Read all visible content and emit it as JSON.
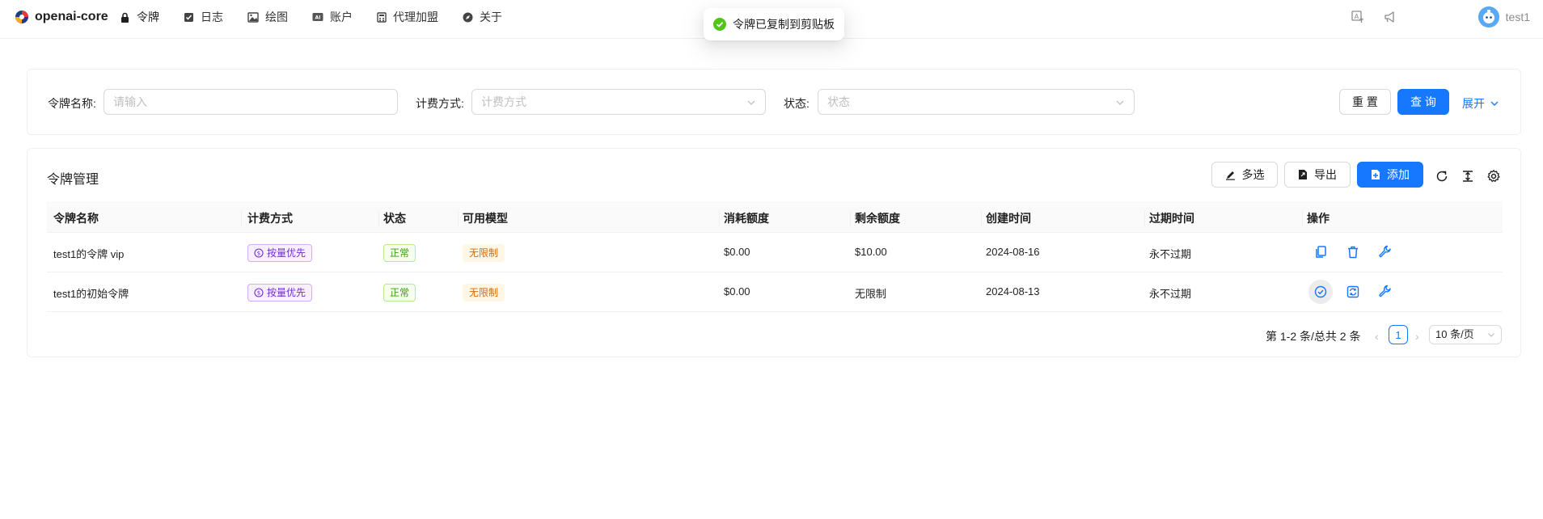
{
  "header": {
    "title": "openai-core",
    "nav": [
      {
        "label": "令牌",
        "icon": "lock-icon"
      },
      {
        "label": "日志",
        "icon": "check-square-icon"
      },
      {
        "label": "绘图",
        "icon": "image-icon"
      },
      {
        "label": "账户",
        "icon": "ai-badge-icon"
      },
      {
        "label": "代理加盟",
        "icon": "calculator-icon"
      },
      {
        "label": "关于",
        "icon": "compass-icon"
      }
    ],
    "right_icons": [
      "translate-icon",
      "notification-icon"
    ],
    "user": "test1"
  },
  "toast": {
    "text": "令牌已复制到剪贴板",
    "icon": "success-check-icon"
  },
  "search": {
    "name_label": "令牌名称:",
    "name_placeholder": "请输入",
    "billing_label": "计费方式:",
    "billing_placeholder": "计费方式",
    "status_label": "状态:",
    "status_placeholder": "状态",
    "reset": "重 置",
    "query": "查 询",
    "expand": "展开"
  },
  "table": {
    "title": "令牌管理",
    "toolbar": {
      "multi_select": "多选",
      "export": "导出",
      "add": "添加"
    },
    "tool_icons": [
      "reload-icon",
      "column-height-icon",
      "settings-icon"
    ],
    "columns": [
      "令牌名称",
      "计费方式",
      "状态",
      "可用模型",
      "消耗额度",
      "剩余额度",
      "创建时间",
      "过期时间",
      "操作"
    ],
    "rows": [
      {
        "name": "test1的令牌 vip",
        "billing": "按量优先",
        "status": "正常",
        "models": "无限制",
        "used": "$0.00",
        "remaining": "$10.00",
        "created": "2024-08-16",
        "expires": "永不过期",
        "actions": [
          "copy-icon",
          "delete-icon",
          "edit-wrench-icon"
        ]
      },
      {
        "name": "test1的初始令牌",
        "billing": "按量优先",
        "status": "正常",
        "models": "无限制",
        "used": "$0.00",
        "remaining": "无限制",
        "created": "2024-08-13",
        "expires": "永不过期",
        "actions": [
          "check-circle-icon",
          "refresh-icon",
          "edit-wrench-icon"
        ]
      }
    ]
  },
  "pagination": {
    "summary": "第 1-2 条/总共 2 条",
    "current_page": "1",
    "page_size": "10 条/页"
  },
  "colors": {
    "primary": "#1677ff",
    "success": "#52c41a",
    "purple": "#722ed1",
    "orange": "#d46b08"
  }
}
